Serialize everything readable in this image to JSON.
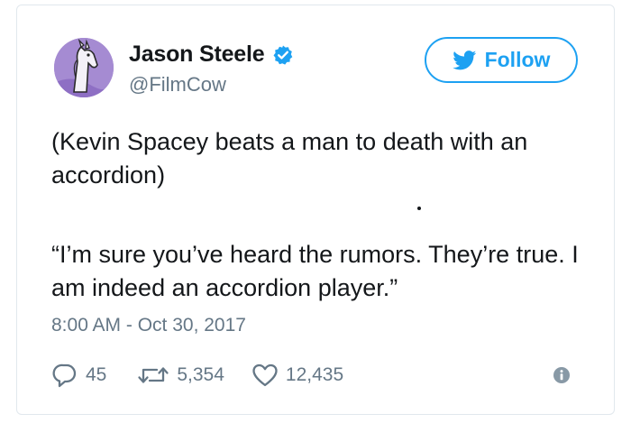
{
  "user": {
    "display_name": "Jason Steele",
    "handle": "@FilmCow",
    "verified": true,
    "avatar": "purple-llama-drawing"
  },
  "follow_button": {
    "label": "Follow",
    "icon": "twitter-bird-icon"
  },
  "tweet": {
    "paragraphs": [
      "(Kevin Spacey beats a man to death with an accordion)",
      "“I’m sure you’ve heard the rumors. They’re true. I am indeed an accordion player.”"
    ],
    "timestamp": "8:00 AM - Oct 30, 2017"
  },
  "actions": {
    "replies": "45",
    "retweets": "5,354",
    "likes": "12,435"
  },
  "colors": {
    "accent": "#1da1f2",
    "secondary_text": "#657786",
    "primary_text": "#14171a",
    "border": "#e1e8ed"
  }
}
